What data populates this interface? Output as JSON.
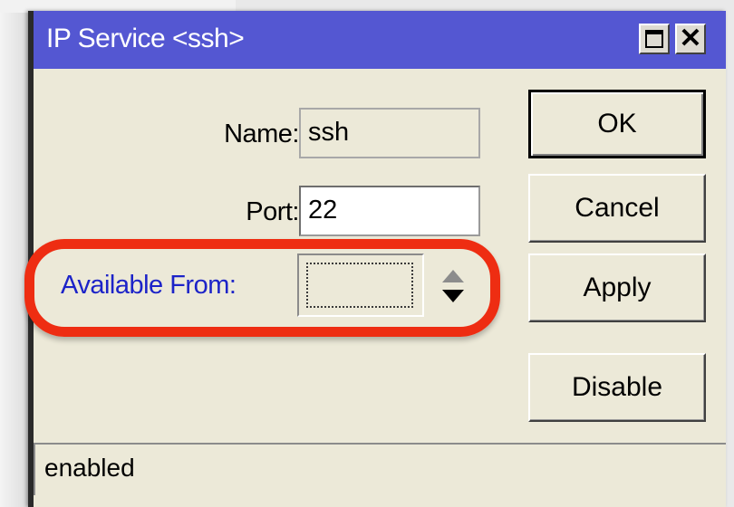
{
  "window": {
    "title": "IP Service <ssh>"
  },
  "form": {
    "name_label": "Name:",
    "name_value": "ssh",
    "port_label": "Port:",
    "port_value": "22",
    "available_from_label": "Available From:",
    "available_from_value": ""
  },
  "buttons": {
    "ok": "OK",
    "cancel": "Cancel",
    "apply": "Apply",
    "disable": "Disable"
  },
  "status": {
    "text": "enabled"
  },
  "colors": {
    "titlebar": "#5457d2",
    "highlight": "#ee2d12",
    "link_label": "#1c23c8"
  },
  "icons": {
    "maximize": "maximize-icon",
    "close": "close-icon",
    "updown": "up-down-arrows-icon"
  }
}
